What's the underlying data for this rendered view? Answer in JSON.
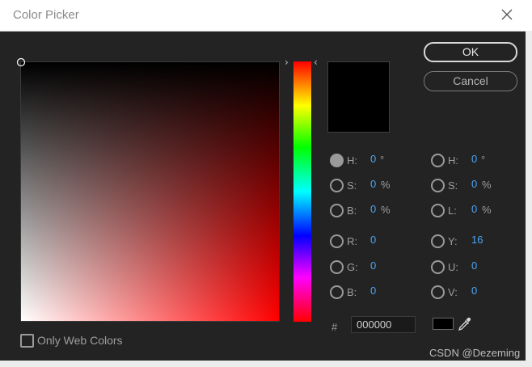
{
  "window": {
    "title": "Color Picker"
  },
  "buttons": {
    "ok": "OK",
    "cancel": "Cancel"
  },
  "hsb": [
    {
      "label": "H:",
      "value": "0",
      "unit": "°",
      "selected": true
    },
    {
      "label": "S:",
      "value": "0",
      "unit": "%",
      "selected": false
    },
    {
      "label": "B:",
      "value": "0",
      "unit": "%",
      "selected": false
    }
  ],
  "rgb": [
    {
      "label": "R:",
      "value": "0",
      "unit": "",
      "selected": false
    },
    {
      "label": "G:",
      "value": "0",
      "unit": "",
      "selected": false
    },
    {
      "label": "B:",
      "value": "0",
      "unit": "",
      "selected": false
    }
  ],
  "hsl": [
    {
      "label": "H:",
      "value": "0",
      "unit": "°",
      "selected": false
    },
    {
      "label": "S:",
      "value": "0",
      "unit": "%",
      "selected": false
    },
    {
      "label": "L:",
      "value": "0",
      "unit": "%",
      "selected": false
    }
  ],
  "yuv": [
    {
      "label": "Y:",
      "value": "16",
      "unit": "",
      "selected": false
    },
    {
      "label": "U:",
      "value": "0",
      "unit": "",
      "selected": false
    },
    {
      "label": "V:",
      "value": "0",
      "unit": "",
      "selected": false
    }
  ],
  "hex": {
    "hash": "#",
    "value": "000000"
  },
  "web_colors": {
    "label": "Only Web Colors",
    "checked": false
  },
  "current_color": "#000000",
  "watermark": "CSDN @Dezeming",
  "icons": {
    "close": "close-icon",
    "eyedropper": "eyedropper-icon",
    "hue_left": "›",
    "hue_right": "‹"
  }
}
